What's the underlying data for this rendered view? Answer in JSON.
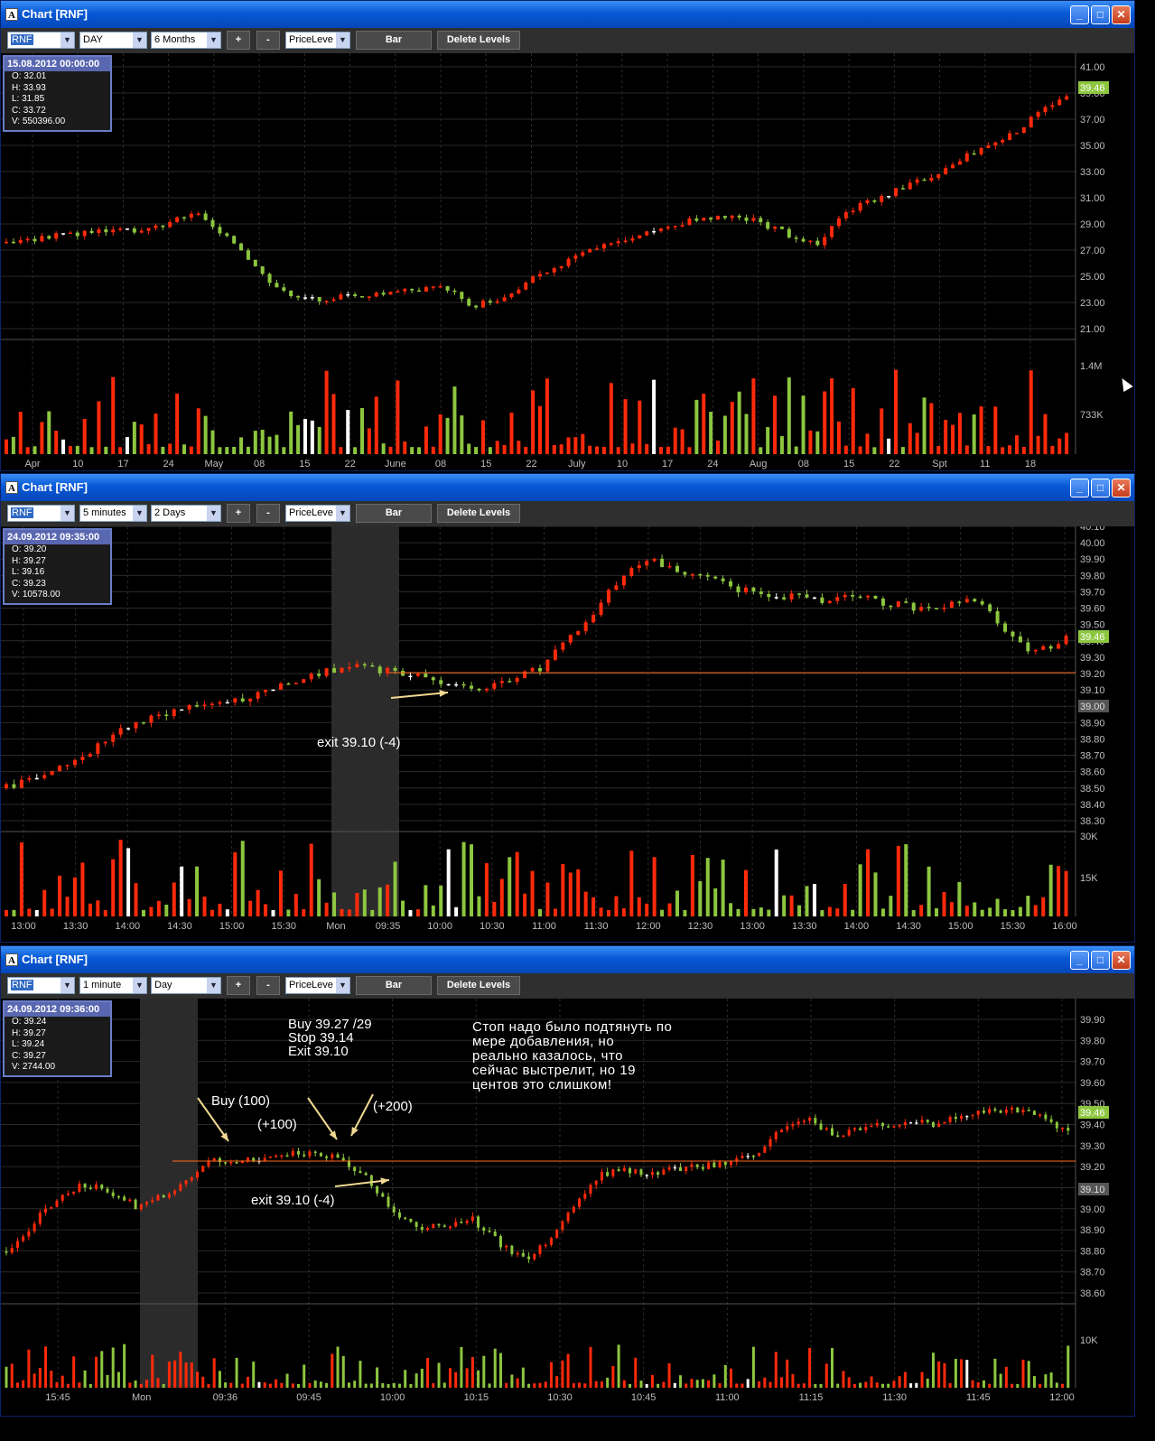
{
  "colors": {
    "up": "#8dc63f",
    "down": "#ff2a0a",
    "neutral": "#ffffff",
    "grid": "#2a2a2a",
    "axis": "#bdbdbd",
    "level": "#ff6a1a",
    "price_badge": "#8dc63f",
    "shade": "#2b2b2b"
  },
  "windows": [
    {
      "title": "Chart [RNF]",
      "symbol": "RNF",
      "interval": "DAY",
      "range": "6 Months",
      "plus": "+",
      "minus": "-",
      "level_mode": "PriceLeve",
      "bar_label": "Bar",
      "delete_label": "Delete Levels",
      "info": {
        "date": "15.08.2012 00:00:00",
        "o": "O: 32.01",
        "h": "H: 33.93",
        "l": "L: 31.85",
        "c": "C: 33.72",
        "v": "V: 550396.00"
      },
      "price_labels": [
        "41.00",
        "39.00",
        "37.00",
        "35.00",
        "33.00",
        "31.00",
        "29.00",
        "27.00",
        "25.00",
        "23.00",
        "21.00"
      ],
      "volume_labels": [
        "1.4M",
        "733K"
      ],
      "last_price": "39.46",
      "time_labels": [
        "Apr",
        "10",
        "17",
        "24",
        "May",
        "08",
        "15",
        "22",
        "June",
        "08",
        "15",
        "22",
        "July",
        "10",
        "17",
        "24",
        "Aug",
        "08",
        "15",
        "22",
        "Spt",
        "11",
        "18"
      ]
    },
    {
      "title": "Chart [RNF]",
      "symbol": "RNF",
      "interval": "5 minutes",
      "range": "2 Days",
      "plus": "+",
      "minus": "-",
      "level_mode": "PriceLeve",
      "bar_label": "Bar",
      "delete_label": "Delete Levels",
      "info": {
        "date": "24.09.2012 09:35:00",
        "o": "O: 39.20",
        "h": "H: 39.27",
        "l": "L: 39.16",
        "c": "C: 39.23",
        "v": "V: 10578.00"
      },
      "price_labels": [
        "40.10",
        "40.00",
        "39.90",
        "39.80",
        "39.70",
        "39.60",
        "39.50",
        "39.40",
        "39.30",
        "39.20",
        "39.10",
        "39.00",
        "38.90",
        "38.80",
        "38.70",
        "38.60",
        "38.50",
        "38.40",
        "38.30"
      ],
      "volume_labels": [
        "30K",
        "15K"
      ],
      "last_price": "39.46",
      "level_price": "39.00",
      "time_labels": [
        "13:00",
        "13:30",
        "14:00",
        "14:30",
        "15:00",
        "15:30",
        "Mon",
        "09:35",
        "10:00",
        "10:30",
        "11:00",
        "11:30",
        "12:00",
        "12:30",
        "13:00",
        "13:30",
        "14:00",
        "14:30",
        "15:00",
        "15:30",
        "16:00"
      ],
      "annotations": [
        "exit 39.10 (-4)"
      ]
    },
    {
      "title": "Chart [RNF]",
      "symbol": "RNF",
      "interval": "1 minute",
      "range": "Day",
      "plus": "+",
      "minus": "-",
      "level_mode": "PriceLeve",
      "bar_label": "Bar",
      "delete_label": "Delete Levels",
      "info": {
        "date": "24.09.2012 09:36:00",
        "o": "O: 39.24",
        "h": "H: 39.27",
        "l": "L: 39.24",
        "c": "C: 39.27",
        "v": "V: 2744.00"
      },
      "price_labels": [
        "39.90",
        "39.80",
        "39.70",
        "39.60",
        "39.50",
        "39.40",
        "39.30",
        "39.20",
        "39.10",
        "39.00",
        "38.90",
        "38.80",
        "38.70",
        "38.60"
      ],
      "volume_labels": [
        "10K"
      ],
      "last_price": "39.46",
      "level_price": "39.10",
      "time_labels": [
        "15:45",
        "Mon",
        "09:36",
        "09:45",
        "10:00",
        "10:15",
        "10:30",
        "10:45",
        "11:00",
        "11:15",
        "11:30",
        "11:45",
        "12:00"
      ],
      "annotations": {
        "trade": "Buy 39.27 /29\nStop 39.14\nExit 39.10",
        "comment": "Стоп надо было подтянуть по\nмере добавления, но\nреально казалось, что\nсейчас выстрелит, но 19\nцентов это слишком!",
        "buy": "Buy (100)",
        "add1": "(+100)",
        "add2": "(+200)",
        "exit": "exit 39.10 (-4)"
      }
    }
  ]
}
